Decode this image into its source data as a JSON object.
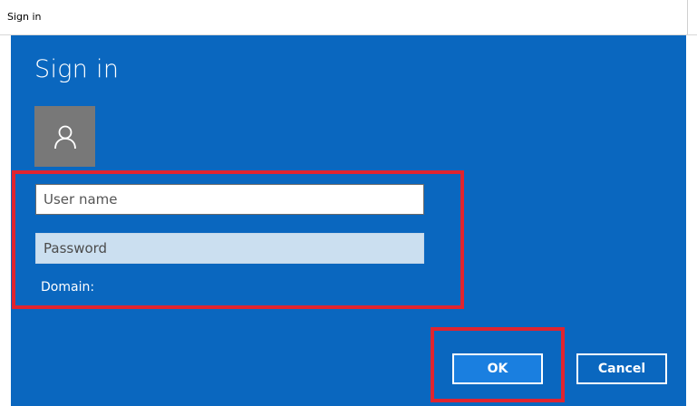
{
  "window": {
    "title": "Sign in"
  },
  "dialog": {
    "heading": "Sign in",
    "avatar_icon": "user-icon",
    "username": {
      "value": "",
      "placeholder": "User name"
    },
    "password": {
      "value": "",
      "placeholder": "Password"
    },
    "domain_label": "Domain:",
    "ok_label": "OK",
    "cancel_label": "Cancel"
  },
  "colors": {
    "panel_background": "#0a67bf",
    "highlight_border": "#e0242f",
    "ok_button": "#1a7fe0",
    "avatar_background": "#787878"
  }
}
